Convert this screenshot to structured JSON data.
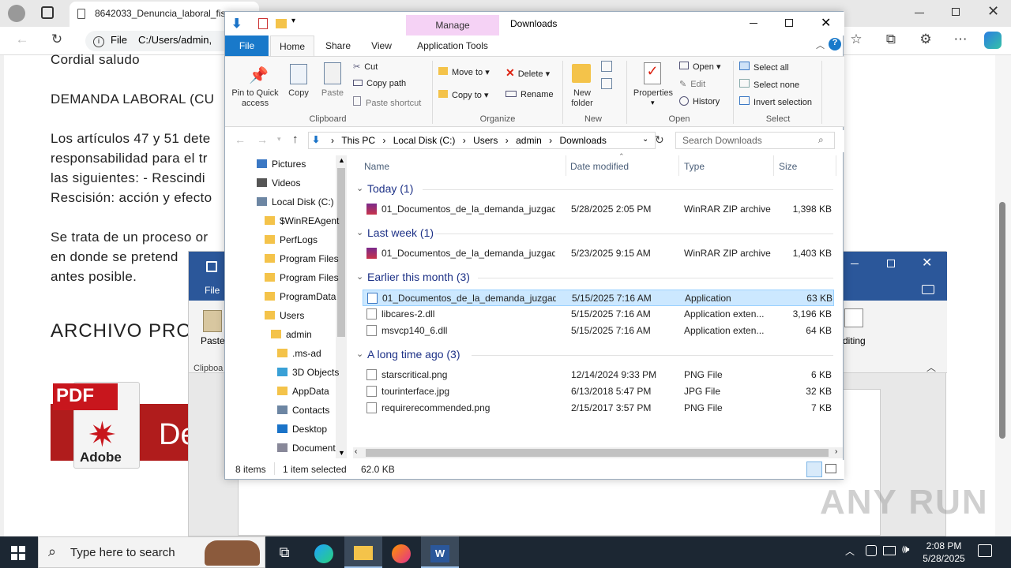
{
  "browser": {
    "tab_title": "8642033_Denuncia_laboral_fisc",
    "address_label": "File",
    "address_path": "C:/Users/admin,"
  },
  "document": {
    "lines": [
      "Cordial saludo",
      "DEMANDA LABORAL (CU",
      "Los artículos 47 y 51 dete",
      "responsabilidad para el tr",
      "las siguientes: - Rescindi",
      "Rescisión: acción y efecto",
      "Se trata de un proceso or",
      "en donde se pretend",
      "antes posible."
    ],
    "heading": "ARCHIVO PRO",
    "pdf_logo_text": "PDF",
    "adobe_text": "Adobe",
    "banner_text": "De"
  },
  "word": {
    "file_tab": "File",
    "paste_label": "Paste",
    "clipboard_label": "Clipboa",
    "editing_label": "Editing"
  },
  "explorer": {
    "title": "Downloads",
    "manage_label": "Manage",
    "tabs": [
      "File",
      "Home",
      "Share",
      "View",
      "Application Tools"
    ],
    "ribbon": {
      "clipboard": {
        "pin_label": "Pin to Quick access",
        "copy_label": "Copy",
        "paste_label": "Paste",
        "cut": "Cut",
        "copy_path": "Copy path",
        "paste_shortcut": "Paste shortcut",
        "group": "Clipboard"
      },
      "organize": {
        "move_to": "Move to",
        "copy_to": "Copy to",
        "delete": "Delete",
        "rename": "Rename",
        "group": "Organize"
      },
      "new": {
        "new_folder": "New folder",
        "group": "New"
      },
      "open": {
        "properties": "Properties",
        "open": "Open",
        "edit": "Edit",
        "history": "History",
        "group": "Open"
      },
      "select": {
        "select_all": "Select all",
        "select_none": "Select none",
        "invert": "Invert selection",
        "group": "Select"
      }
    },
    "path": [
      "This PC",
      "Local Disk (C:)",
      "Users",
      "admin",
      "Downloads"
    ],
    "search_placeholder": "Search Downloads",
    "tree": [
      {
        "label": "Pictures",
        "icon": "pictures-icon"
      },
      {
        "label": "Videos",
        "icon": "videos-icon"
      },
      {
        "label": "Local Disk (C:)",
        "icon": "drive-icon"
      },
      {
        "label": "$WinREAgent",
        "icon": "folder-icon"
      },
      {
        "label": "PerfLogs",
        "icon": "folder-icon"
      },
      {
        "label": "Program Files",
        "icon": "folder-icon"
      },
      {
        "label": "Program Files",
        "icon": "folder-icon"
      },
      {
        "label": "ProgramData",
        "icon": "folder-icon"
      },
      {
        "label": "Users",
        "icon": "folder-icon"
      },
      {
        "label": "admin",
        "icon": "folder-icon"
      },
      {
        "label": ".ms-ad",
        "icon": "folder-icon"
      },
      {
        "label": "3D Objects",
        "icon": "3d-objects-icon"
      },
      {
        "label": "AppData",
        "icon": "folder-icon"
      },
      {
        "label": "Contacts",
        "icon": "contacts-icon"
      },
      {
        "label": "Desktop",
        "icon": "desktop-icon"
      },
      {
        "label": "Document",
        "icon": "documents-icon"
      }
    ],
    "columns": [
      "Name",
      "Date modified",
      "Type",
      "Size"
    ],
    "groups": [
      {
        "header": "Today (1)",
        "files": [
          {
            "name": "01_Documentos_de_la_demanda_juzgad...",
            "date": "5/28/2025 2:05 PM",
            "type": "WinRAR ZIP archive",
            "size": "1,398 KB",
            "icon": "winrar-icon"
          }
        ]
      },
      {
        "header": "Last week (1)",
        "files": [
          {
            "name": "01_Documentos_de_la_demanda_juzgad...",
            "date": "5/23/2025 9:15 AM",
            "type": "WinRAR ZIP archive",
            "size": "1,403 KB",
            "icon": "winrar-icon"
          }
        ]
      },
      {
        "header": "Earlier this month (3)",
        "files": [
          {
            "name": "01_Documentos_de_la_demanda_juzgad...",
            "date": "5/15/2025 7:16 AM",
            "type": "Application",
            "size": "63 KB",
            "icon": "application-icon",
            "selected": true
          },
          {
            "name": "libcares-2.dll",
            "date": "5/15/2025 7:16 AM",
            "type": "Application exten...",
            "size": "3,196 KB",
            "icon": "dll-icon"
          },
          {
            "name": "msvcp140_6.dll",
            "date": "5/15/2025 7:16 AM",
            "type": "Application exten...",
            "size": "64 KB",
            "icon": "dll-icon"
          }
        ]
      },
      {
        "header": "A long time ago (3)",
        "files": [
          {
            "name": "starscritical.png",
            "date": "12/14/2024 9:33 PM",
            "type": "PNG File",
            "size": "6 KB",
            "icon": "image-file-icon"
          },
          {
            "name": "tourinterface.jpg",
            "date": "6/13/2018 5:47 PM",
            "type": "JPG File",
            "size": "32 KB",
            "icon": "image-file-icon"
          },
          {
            "name": "requirerecommended.png",
            "date": "2/15/2017 3:57 PM",
            "type": "PNG File",
            "size": "7 KB",
            "icon": "image-file-icon"
          }
        ]
      }
    ],
    "status": {
      "items": "8 items",
      "selected": "1 item selected",
      "size": "62.0 KB"
    }
  },
  "taskbar": {
    "search_placeholder": "Type here to search",
    "time": "2:08 PM",
    "date": "5/28/2025"
  },
  "watermark": "ANY RUN"
}
